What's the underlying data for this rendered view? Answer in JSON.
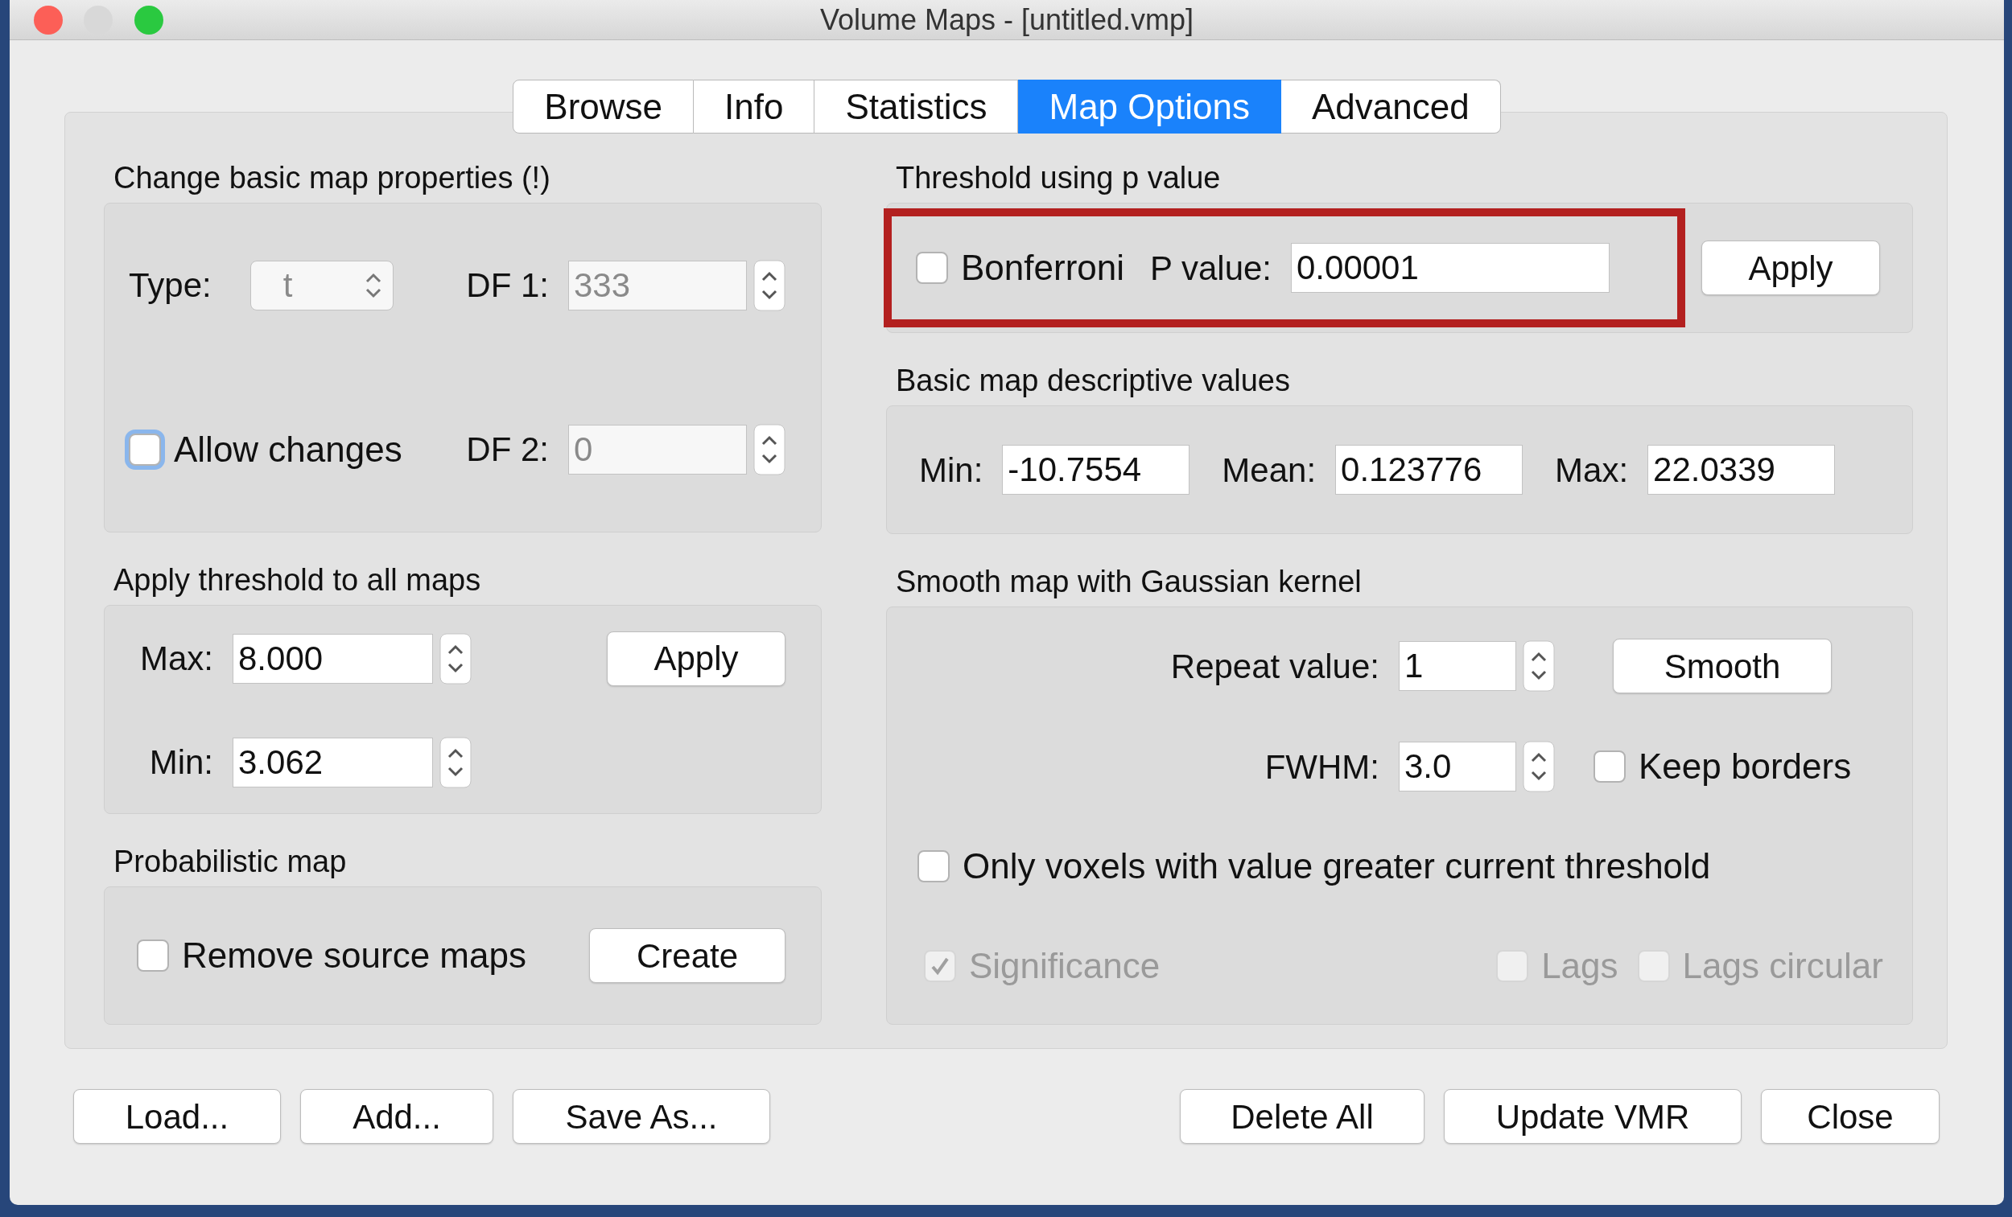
{
  "window": {
    "title": "Volume Maps - [untitled.vmp]"
  },
  "tabs": [
    {
      "label": "Browse",
      "selected": false
    },
    {
      "label": "Info",
      "selected": false
    },
    {
      "label": "Statistics",
      "selected": false
    },
    {
      "label": "Map Options",
      "selected": true
    },
    {
      "label": "Advanced",
      "selected": false
    }
  ],
  "basic_properties": {
    "title": "Change basic map properties (!)",
    "type_label": "Type:",
    "type_value": "t",
    "type_disabled": true,
    "df1_label": "DF 1:",
    "df1_value": "333",
    "df1_disabled": true,
    "df2_label": "DF 2:",
    "df2_value": "0",
    "df2_disabled": true,
    "allow_changes": {
      "label": "Allow changes",
      "checked": false,
      "focused": true,
      "disabled": false
    }
  },
  "threshold_all": {
    "title": "Apply threshold to all maps",
    "max_label": "Max:",
    "max_value": "8.000",
    "min_label": "Min:",
    "min_value": "3.062",
    "apply": "Apply"
  },
  "probabilistic": {
    "title": "Probabilistic map",
    "remove_source": {
      "label": "Remove source maps",
      "checked": false,
      "disabled": false
    },
    "create": "Create"
  },
  "p_threshold": {
    "title": "Threshold using p value",
    "highlighted": true,
    "bonferroni": {
      "label": "Bonferroni",
      "checked": false,
      "disabled": false
    },
    "p_label": "P value:",
    "p_value": "0.00001",
    "apply": "Apply"
  },
  "descriptive": {
    "title": "Basic map descriptive values",
    "fields": [
      {
        "label": "Min:",
        "value": "-10.7554"
      },
      {
        "label": "Mean:",
        "value": "0.123776"
      },
      {
        "label": "Max:",
        "value": "22.0339"
      }
    ]
  },
  "smooth": {
    "title": "Smooth map with Gaussian kernel",
    "repeat_label": "Repeat value:",
    "repeat_value": "1",
    "smooth": "Smooth",
    "fwhm_label": "FWHM:",
    "fwhm_value": "3.0",
    "keep_borders": {
      "label": "Keep borders",
      "checked": false,
      "disabled": false
    },
    "only_voxels": {
      "label": "Only voxels with value greater current threshold",
      "checked": false,
      "disabled": false
    },
    "significance": {
      "label": "Significance",
      "checked": true,
      "disabled": true
    },
    "lags": {
      "label": "Lags",
      "checked": false,
      "disabled": true
    },
    "lags_circular": {
      "label": "Lags circular",
      "checked": false,
      "disabled": true
    }
  },
  "buttons_left": [
    "Load...",
    "Add...",
    "Save As..."
  ],
  "buttons_right": [
    "Delete All",
    "Update VMR",
    "Close"
  ]
}
